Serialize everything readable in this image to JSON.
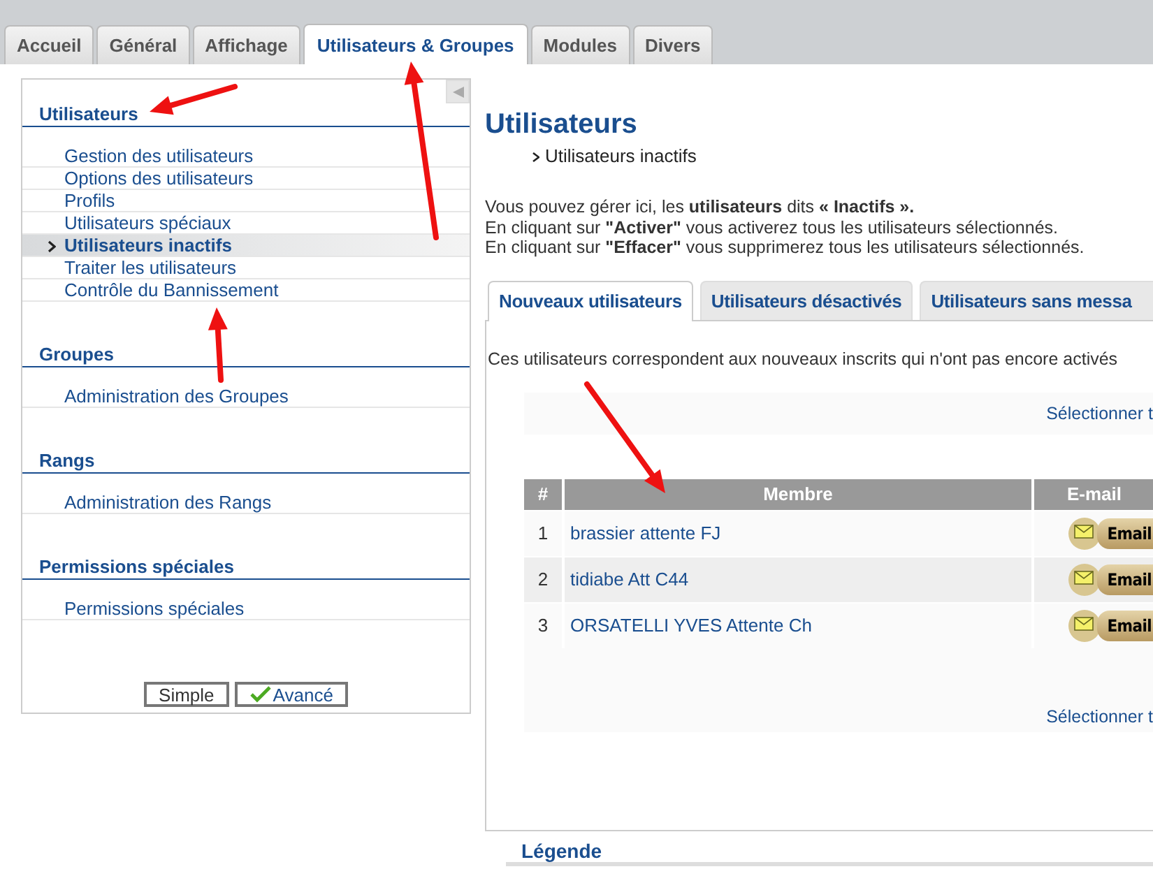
{
  "tabs": [
    {
      "label": "Accueil",
      "selected": false
    },
    {
      "label": "Général",
      "selected": false
    },
    {
      "label": "Affichage",
      "selected": false
    },
    {
      "label": "Utilisateurs & Groupes",
      "selected": true
    },
    {
      "label": "Modules",
      "selected": false
    },
    {
      "label": "Divers",
      "selected": false
    }
  ],
  "sidebar": {
    "sections": [
      {
        "title": "Utilisateurs",
        "items": [
          {
            "label": "Gestion des utilisateurs",
            "selected": false
          },
          {
            "label": "Options des utilisateurs",
            "selected": false
          },
          {
            "label": "Profils",
            "selected": false
          },
          {
            "label": "Utilisateurs spéciaux",
            "selected": false
          },
          {
            "label": "Utilisateurs inactifs",
            "selected": true
          },
          {
            "label": "Traiter les utilisateurs",
            "selected": false
          },
          {
            "label": "Contrôle du Bannissement",
            "selected": false
          }
        ]
      },
      {
        "title": "Groupes",
        "items": [
          {
            "label": "Administration des Groupes",
            "selected": false
          }
        ]
      },
      {
        "title": "Rangs",
        "items": [
          {
            "label": "Administration des Rangs",
            "selected": false
          }
        ]
      },
      {
        "title": "Permissions spéciales",
        "items": [
          {
            "label": "Permissions spéciales",
            "selected": false
          }
        ]
      }
    ],
    "modes": [
      {
        "label": "Simple",
        "selected": false
      },
      {
        "label": "Avancé",
        "selected": true
      }
    ]
  },
  "page": {
    "title": "Utilisateurs",
    "breadcrumb": "Utilisateurs inactifs",
    "intro_lines": [
      "Vous pouvez gérer ici, les **utilisateurs** dits **« Inactifs ».**",
      "En cliquant sur **\"Activer\"** vous activerez tous les utilisateurs sélectionnés.",
      "En cliquant sur **\"Effacer\"** vous supprimerez tous les utilisateurs sélectionnés."
    ],
    "subtabs": [
      {
        "label": "Nouveaux utilisateurs",
        "selected": true
      },
      {
        "label": "Utilisateurs désactivés",
        "selected": false
      },
      {
        "label": "Utilisateurs sans messa",
        "selected": false
      }
    ],
    "description": "Ces utilisateurs correspondent aux nouveaux inscrits qui n'ont pas encore activés",
    "top_select_link": "Sélectionner t",
    "table": {
      "columns": [
        "#",
        "Membre",
        "E-mail"
      ],
      "rows": [
        {
          "number": "1",
          "member": "brassier attente FJ",
          "email_button": "Email"
        },
        {
          "number": "2",
          "member": "tidiabe Att C44",
          "email_button": "Email"
        },
        {
          "number": "3",
          "member": "ORSATELLI YVES Attente Ch",
          "email_button": "Email"
        }
      ]
    },
    "bottom_select_link": "Sélectionner t",
    "legend_title": "Légende"
  }
}
